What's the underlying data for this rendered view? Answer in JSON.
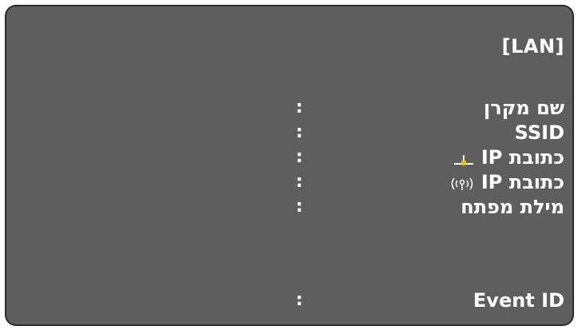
{
  "lan_info": {
    "title": "[LAN]",
    "rows": [
      {
        "label": "שם מקרן",
        "separator": ":"
      },
      {
        "label": "SSID",
        "separator": ":"
      },
      {
        "label": "כתובת IP",
        "icon": "wired-lan-icon",
        "separator": ":"
      },
      {
        "label": "כתובת IP",
        "icon": "wireless-lan-icon",
        "separator": ":"
      },
      {
        "label": "מילת מפתח",
        "separator": ":"
      },
      {
        "label": "Event ID",
        "separator": ":"
      }
    ]
  },
  "colors": {
    "panel_background": "#5e5e5e",
    "text": "#ffffff",
    "wired_icon_accent": "#f0c000"
  }
}
